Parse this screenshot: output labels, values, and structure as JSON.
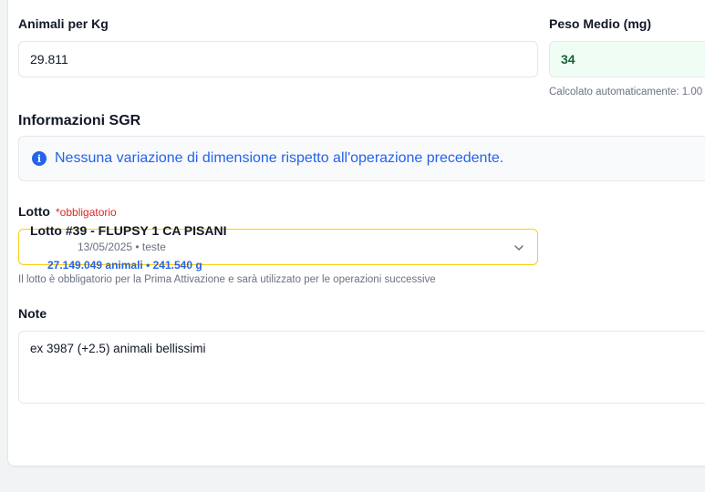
{
  "fields": {
    "animali_per_kg": {
      "label": "Animali per Kg",
      "value": "29.811"
    },
    "peso_medio": {
      "label": "Peso Medio (mg)",
      "value": "34",
      "helper": "Calcolato automaticamente: 1.00"
    }
  },
  "sgr": {
    "title": "Informazioni SGR",
    "icon": "info-icon",
    "message": "Nessuna variazione di dimensione rispetto all'operazione precedente."
  },
  "lotto": {
    "label": "Lotto",
    "required_text": "*obbligatorio",
    "selected": {
      "name": "Lotto #39 - FLUPSY 1 CA PISANI",
      "date_info": "13/05/2025 • teste",
      "stats": "27.149.049 animali • 241.540 g"
    },
    "helper": "Il lotto è obbligatorio per la Prima Attivazione e sarà utilizzato per le operazioni successive"
  },
  "note": {
    "label": "Note",
    "value": "ex 3987 (+2.5) animali bellissimi"
  },
  "colors": {
    "accent_blue": "#2563eb",
    "required_red": "#dc2626",
    "select_border": "#facc15",
    "green_field_bg": "#f0fdf4",
    "green_text": "#166534"
  }
}
